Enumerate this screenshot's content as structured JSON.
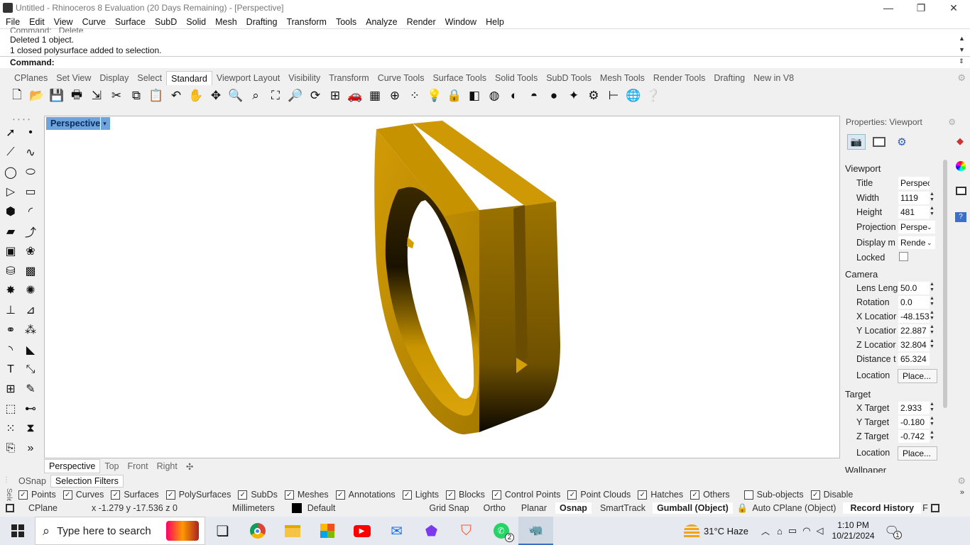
{
  "titlebar": {
    "title": "Untitled - Rhinoceros 8 Evaluation (20 Days Remaining) - [Perspective]",
    "minimize": "—",
    "restore": "❐",
    "close": "✕"
  },
  "menu": [
    "File",
    "Edit",
    "View",
    "Curve",
    "Surface",
    "SubD",
    "Solid",
    "Mesh",
    "Drafting",
    "Transform",
    "Tools",
    "Analyze",
    "Render",
    "Window",
    "Help"
  ],
  "command_history": [
    "Command: _Delete",
    "Deleted 1 object.",
    "1 closed polysurface added to selection."
  ],
  "command_prompt": "Command:",
  "toolbar_tabs": [
    "CPlanes",
    "Set View",
    "Display",
    "Select",
    "Standard",
    "Viewport Layout",
    "Visibility",
    "Transform",
    "Curve Tools",
    "Surface Tools",
    "Solid Tools",
    "SubD Tools",
    "Mesh Tools",
    "Render Tools",
    "Drafting",
    "New in V8"
  ],
  "active_toolbar_tab": "Standard",
  "toolbar_icons": [
    "new-icon",
    "open-icon",
    "save-icon",
    "print-icon",
    "import-icon",
    "cut-icon",
    "copy-icon",
    "paste-icon",
    "undo-icon",
    "pan-icon",
    "rotate-view-icon",
    "zoom-icon",
    "zoom-window-icon",
    "zoom-extents-icon",
    "zoom-selected-icon",
    "rotate-icon",
    "four-viewports-icon",
    "car-icon",
    "grid-icon",
    "cplane-icon",
    "points-icon",
    "bulb-icon",
    "lock-icon",
    "layer-icon",
    "color-wheel-icon",
    "shaded-sphere-icon",
    "rendered-sphere-icon",
    "render-sphere-icon",
    "light-icon",
    "gear-icon",
    "dimension-icon",
    "globe-icon",
    "help-icon"
  ],
  "viewport": {
    "label": "Perspective",
    "dropdown": "▾",
    "tabs": [
      "Perspective",
      "Top",
      "Front",
      "Right"
    ],
    "add_tab": "✣"
  },
  "model_colors": {
    "gold_light": "#d9a20a",
    "gold_mid": "#b98a00",
    "gold_dark": "#7a5a00"
  },
  "properties": {
    "header": "Properties: Viewport",
    "viewport_section": "Viewport",
    "camera_section": "Camera",
    "target_section": "Target",
    "wallpaper_section": "Wallpaper",
    "fields": {
      "title": {
        "label": "Title",
        "value": "Perspecti"
      },
      "width": {
        "label": "Width",
        "value": "1119"
      },
      "height": {
        "label": "Height",
        "value": "481"
      },
      "projection": {
        "label": "Projection",
        "value": "Perspe"
      },
      "display_mode": {
        "label": "Display m",
        "value": "Rende"
      },
      "locked": {
        "label": "Locked"
      },
      "lens_length": {
        "label": "Lens Leng",
        "value": "50.0"
      },
      "rotation": {
        "label": "Rotation",
        "value": "0.0"
      },
      "x_location": {
        "label": "X Locatior",
        "value": "-48.153"
      },
      "y_location": {
        "label": "Y Locatior",
        "value": "22.887"
      },
      "z_location": {
        "label": "Z Locatior",
        "value": "32.804"
      },
      "distance": {
        "label": "Distance t",
        "value": "65.324"
      },
      "cam_location": {
        "label": "Location",
        "button": "Place..."
      },
      "x_target": {
        "label": "X Target",
        "value": "2.933"
      },
      "y_target": {
        "label": "Y Target",
        "value": "-0.180"
      },
      "z_target": {
        "label": "Z Target",
        "value": "-0.742"
      },
      "target_location": {
        "label": "Location",
        "button": "Place..."
      }
    }
  },
  "bottom_tabs": [
    "OSnap",
    "Selection Filters"
  ],
  "active_bottom_tab": "Selection Filters",
  "filters": [
    {
      "label": "Points",
      "checked": true
    },
    {
      "label": "Curves",
      "checked": true
    },
    {
      "label": "Surfaces",
      "checked": true
    },
    {
      "label": "PolySurfaces",
      "checked": true
    },
    {
      "label": "SubDs",
      "checked": true
    },
    {
      "label": "Meshes",
      "checked": true
    },
    {
      "label": "Annotations",
      "checked": true
    },
    {
      "label": "Lights",
      "checked": true
    },
    {
      "label": "Blocks",
      "checked": true
    },
    {
      "label": "Control Points",
      "checked": true
    },
    {
      "label": "Point Clouds",
      "checked": true
    },
    {
      "label": "Hatches",
      "checked": true
    },
    {
      "label": "Others",
      "checked": true
    },
    {
      "label": "Sub-objects",
      "checked": false
    },
    {
      "label": "Disable",
      "checked": true
    }
  ],
  "filters_side_label": "Sele",
  "status": {
    "cplane": "CPlane",
    "coords": "x -1.279  y -17.536  z 0",
    "units": "Millimeters",
    "layer": "Default",
    "grid_snap": "Grid Snap",
    "ortho": "Ortho",
    "planar": "Planar",
    "osnap": "Osnap",
    "smarttrack": "SmartTrack",
    "gumball": "Gumball (Object)",
    "auto_cplane": "Auto CPlane (Object)",
    "record_history": "Record History",
    "filter": "F"
  },
  "taskbar": {
    "search_placeholder": "Type here to search",
    "weather": "31°C  Haze",
    "time": "1:10 PM",
    "date": "10/21/2024",
    "notifications": "1",
    "whatsapp_badge": "2"
  }
}
